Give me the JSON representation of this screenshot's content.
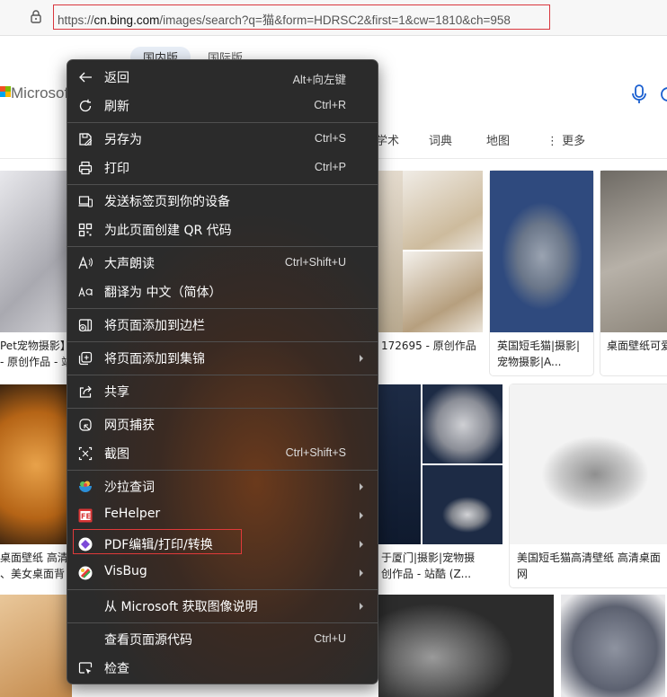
{
  "browser": {
    "url_prefix": "https://",
    "url_host": "cn.bing.com",
    "url_rest": "/images/search?q=猫&form=HDRSC2&first=1&cw=1810&ch=958"
  },
  "bing": {
    "scope_tabs": [
      "国内版",
      "国际版"
    ],
    "logo_text": "Microsoft",
    "nav_tabs": [
      "学术",
      "词典",
      "地图",
      "更多"
    ]
  },
  "results": {
    "row1": [
      {
        "caption_l1": "Pet宠物摄影】",
        "caption_l2": " - 原创作品 - 站"
      },
      {
        "caption_l1": "172695 - 原创作品",
        "caption_l2": ""
      },
      {
        "caption_l1": "英国短毛猫|摄影|",
        "caption_l2": "宠物摄影|A..."
      },
      {
        "caption_l1": "桌面壁纸可爱",
        "caption_l2": ""
      }
    ],
    "row2": [
      {
        "caption_l1": "桌面壁纸 高清",
        "caption_l2": "、美女桌面背"
      },
      {
        "caption_l1": "于厦门|摄影|宠物摄",
        "caption_l2": "创作品 - 站酷 (Z..."
      },
      {
        "caption_l1": "美国短毛猫高清壁纸 高清桌面",
        "caption_l2": "网"
      }
    ]
  },
  "context_menu": {
    "items": [
      {
        "icon": "back-arrow-icon",
        "label": "返回",
        "shortcut": "Alt+向左键",
        "submenu": false
      },
      {
        "icon": "refresh-icon",
        "label": "刷新",
        "shortcut": "Ctrl+R",
        "submenu": false
      },
      {
        "icon": "save-as-icon",
        "label": "另存为",
        "shortcut": "Ctrl+S",
        "submenu": false
      },
      {
        "icon": "printer-icon",
        "label": "打印",
        "shortcut": "Ctrl+P",
        "submenu": false
      },
      {
        "icon": "send-to-device-icon",
        "label": "发送标签页到你的设备",
        "shortcut": "",
        "submenu": false
      },
      {
        "icon": "qr-code-icon",
        "label": "为此页面创建 QR 代码",
        "shortcut": "",
        "submenu": false
      },
      {
        "icon": "read-aloud-icon",
        "label": "大声朗读",
        "shortcut": "Ctrl+Shift+U",
        "submenu": false
      },
      {
        "icon": "translate-icon",
        "label": "翻译为 中文（简体）",
        "shortcut": "",
        "submenu": false
      },
      {
        "icon": "add-to-sidebar-icon",
        "label": "将页面添加到边栏",
        "shortcut": "",
        "submenu": false
      },
      {
        "icon": "collections-icon",
        "label": "将页面添加到集锦",
        "shortcut": "",
        "submenu": true
      },
      {
        "icon": "share-icon",
        "label": "共享",
        "shortcut": "",
        "submenu": false
      },
      {
        "icon": "web-capture-icon",
        "label": "网页捕获",
        "shortcut": "",
        "submenu": false
      },
      {
        "icon": "screenshot-icon",
        "label": "截图",
        "shortcut": "Ctrl+Shift+S",
        "submenu": false
      },
      {
        "icon": "salad-dictionary-icon",
        "label": "沙拉查词",
        "shortcut": "",
        "submenu": true
      },
      {
        "icon": "fehelper-icon",
        "label": "FeHelper",
        "shortcut": "",
        "submenu": true
      },
      {
        "icon": "pdf-editor-icon",
        "label": "PDF编辑/打印/转换",
        "shortcut": "",
        "submenu": true
      },
      {
        "icon": "visbug-icon",
        "label": "VisBug",
        "shortcut": "",
        "submenu": true
      },
      {
        "icon": "",
        "label": "从 Microsoft 获取图像说明",
        "shortcut": "",
        "submenu": true
      },
      {
        "icon": "",
        "label": "查看页面源代码",
        "shortcut": "Ctrl+U",
        "submenu": false
      },
      {
        "icon": "inspect-icon",
        "label": "检查",
        "shortcut": "",
        "submenu": false
      }
    ]
  },
  "colors": {
    "highlight_border": "#e03a3a",
    "menu_bg": "#2b2b2b",
    "menu_text": "#ffffff"
  }
}
